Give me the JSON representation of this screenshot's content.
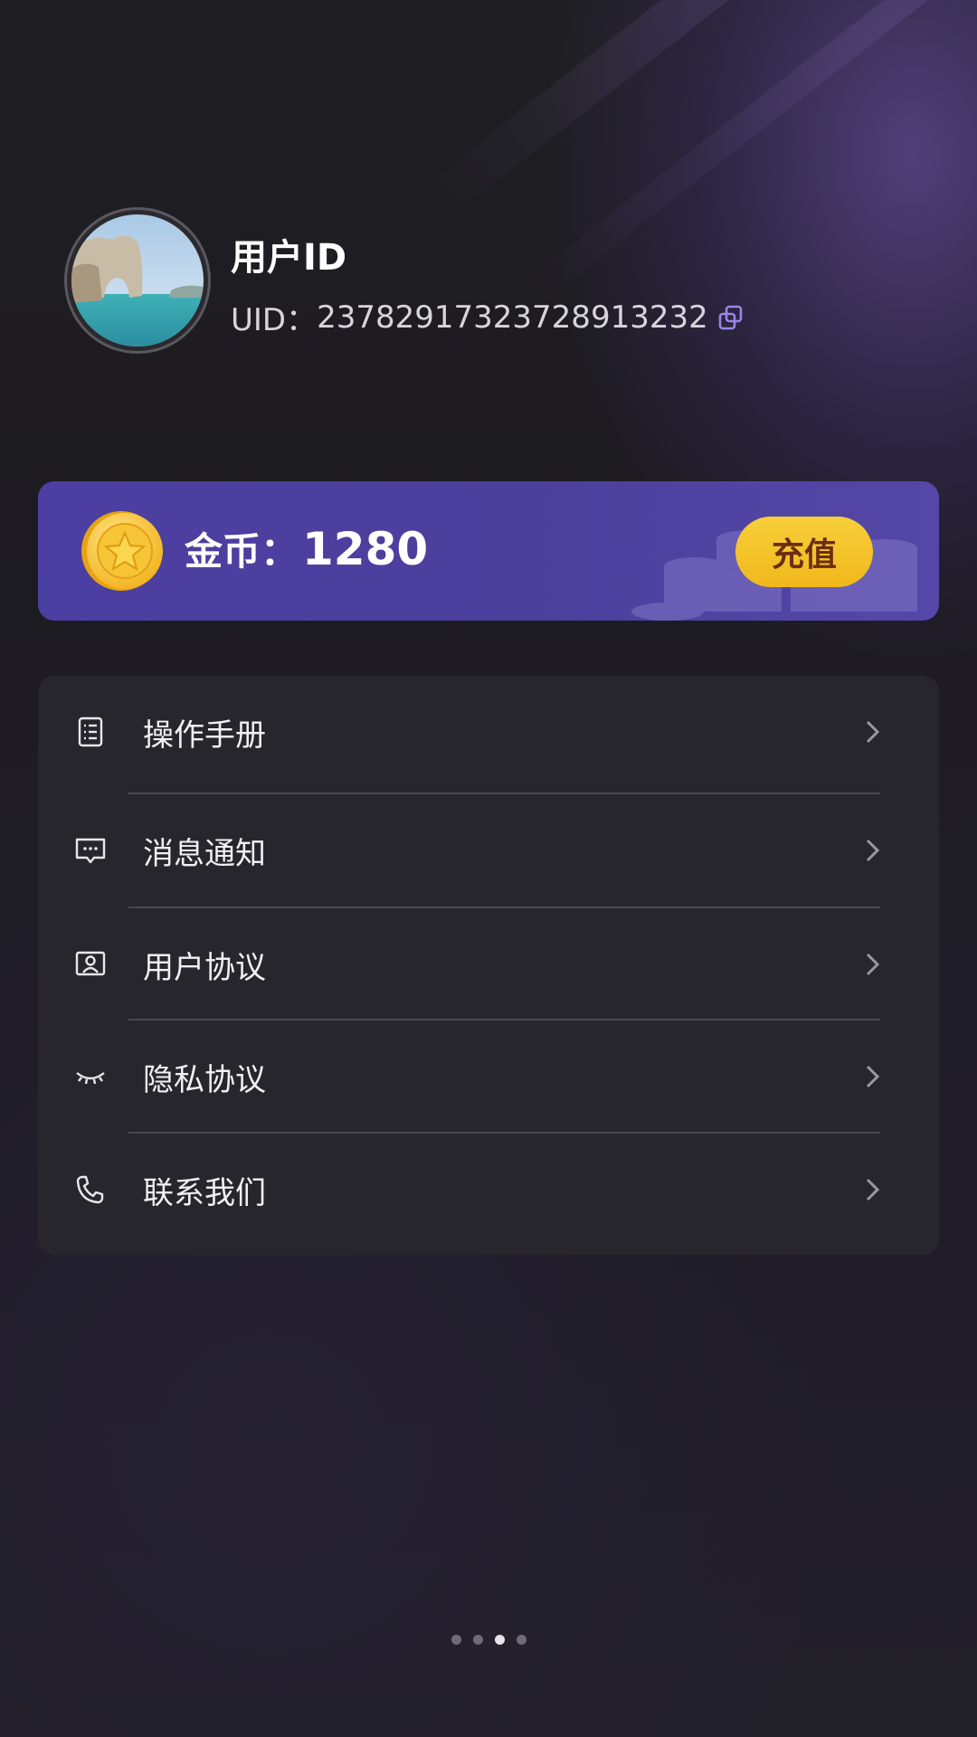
{
  "profile": {
    "username": "用户ID",
    "uid_label": "UID：",
    "uid_value": "23782917323728913232"
  },
  "coins": {
    "label": "金币：",
    "amount": "1280",
    "recharge_label": "充值"
  },
  "menu": {
    "items": [
      {
        "label": "操作手册",
        "icon": "manual-list-icon"
      },
      {
        "label": "消息通知",
        "icon": "message-icon"
      },
      {
        "label": "用户协议",
        "icon": "user-agreement-icon"
      },
      {
        "label": "隐私协议",
        "icon": "closed-eye-icon"
      },
      {
        "label": "联系我们",
        "icon": "phone-icon"
      }
    ]
  },
  "pager": {
    "count": 4,
    "active_index": 2
  },
  "colors": {
    "background": "#201e25",
    "accent_purple": "#4c3fa2",
    "recharge_yellow": "#f1b81c",
    "recharge_text": "#6b2d10"
  }
}
